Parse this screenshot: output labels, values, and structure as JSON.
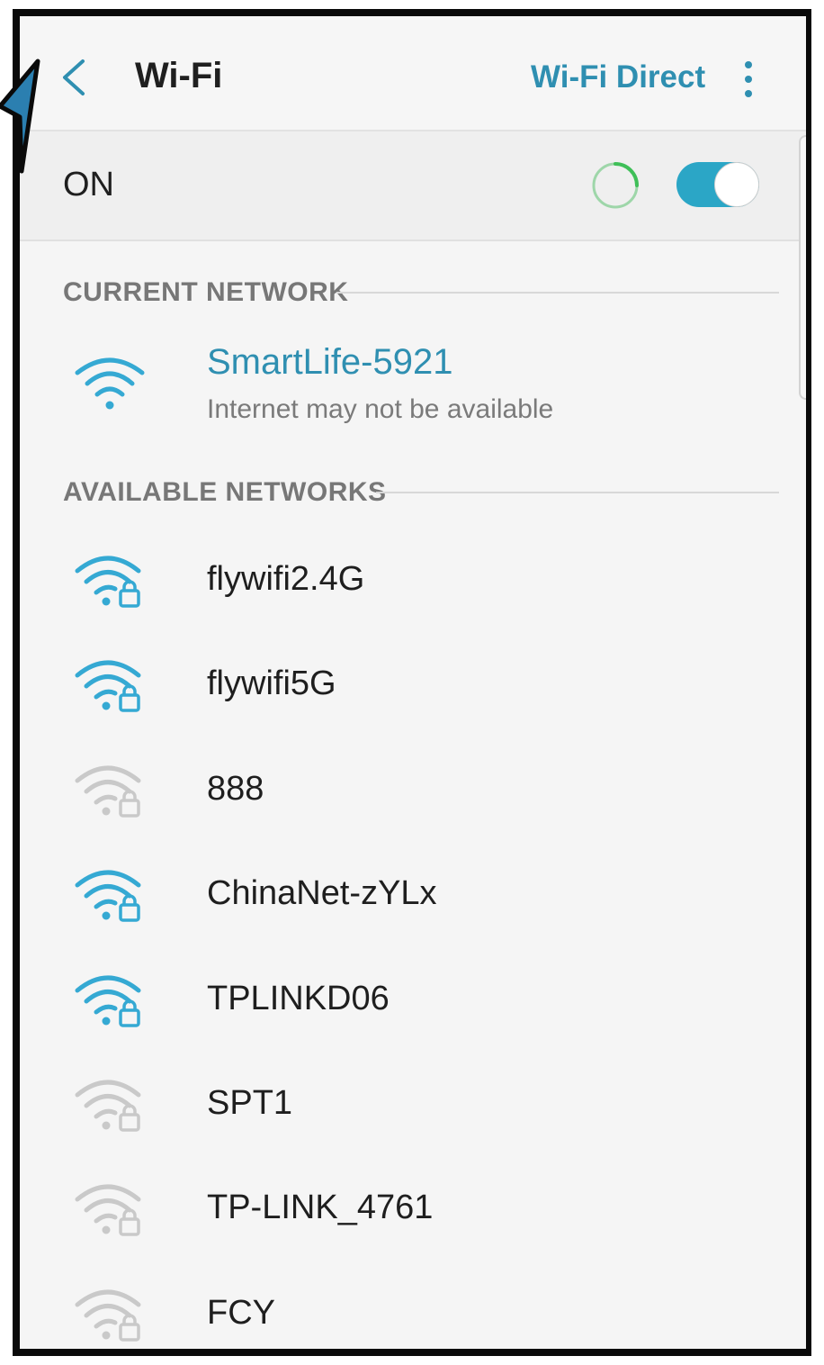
{
  "header": {
    "title": "Wi-Fi",
    "wifi_direct_label": "Wi-Fi Direct"
  },
  "wifi_toggle": {
    "label": "ON",
    "state": "on"
  },
  "sections": {
    "current_label": "CURRENT NETWORK",
    "available_label": "AVAILABLE NETWORKS"
  },
  "current_network": {
    "name": "SmartLife-5921",
    "status": "Internet may not be available",
    "strength": "strong",
    "secured": false
  },
  "available_networks": [
    {
      "name": "flywifi2.4G",
      "strength": "strong",
      "secured": true
    },
    {
      "name": "flywifi5G",
      "strength": "strong",
      "secured": true
    },
    {
      "name": "888",
      "strength": "weak",
      "secured": true
    },
    {
      "name": "ChinaNet-zYLx",
      "strength": "strong",
      "secured": true
    },
    {
      "name": "TPLINKD06",
      "strength": "strong",
      "secured": true
    },
    {
      "name": "SPT1",
      "strength": "weak",
      "secured": true
    },
    {
      "name": "TP-LINK_4761",
      "strength": "weak",
      "secured": true
    },
    {
      "name": "FCY",
      "strength": "weak",
      "secured": true
    }
  ],
  "colors": {
    "accent": "#2f8fb1",
    "toggle_on": "#2ba6c6",
    "signal_strong": "#35a9d3",
    "signal_weak": "#c9c9c9",
    "spinner": "#3fbf58"
  }
}
